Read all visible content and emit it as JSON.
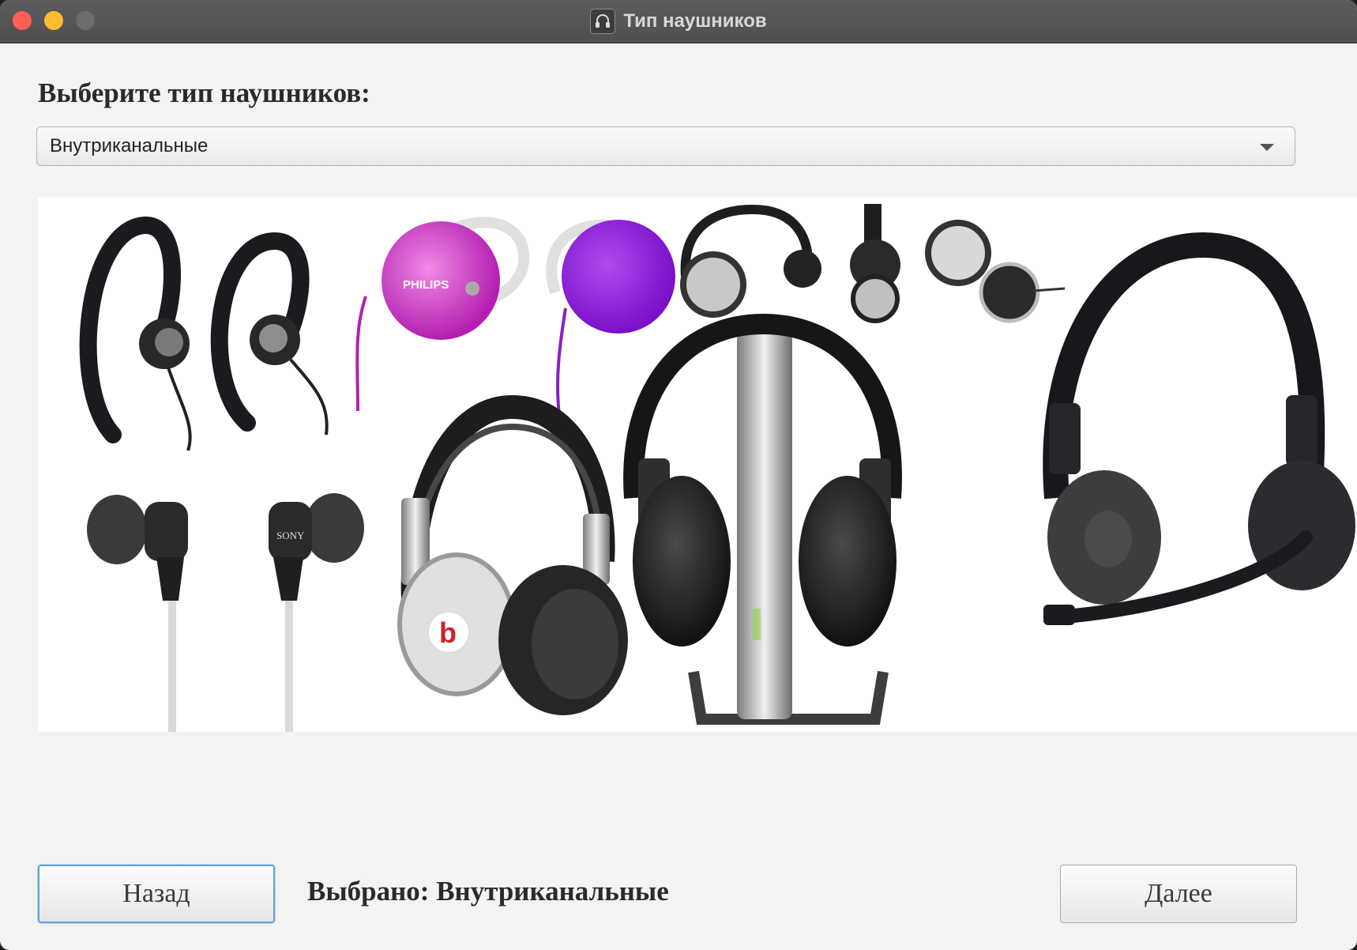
{
  "window": {
    "title": "Тип наушников",
    "title_icon": "headphones-icon"
  },
  "form": {
    "prompt": "Выберите тип наушников:",
    "select_value": "Внутриканальные"
  },
  "image": {
    "description_icon": "headphones-collage"
  },
  "footer": {
    "back_label": "Назад",
    "status": "Выбрано: Внутриканальные",
    "next_label": "Далее"
  },
  "colors": {
    "accent": "#63a2de",
    "titlebar": "#555555",
    "window_bg": "#f3f3f3"
  }
}
